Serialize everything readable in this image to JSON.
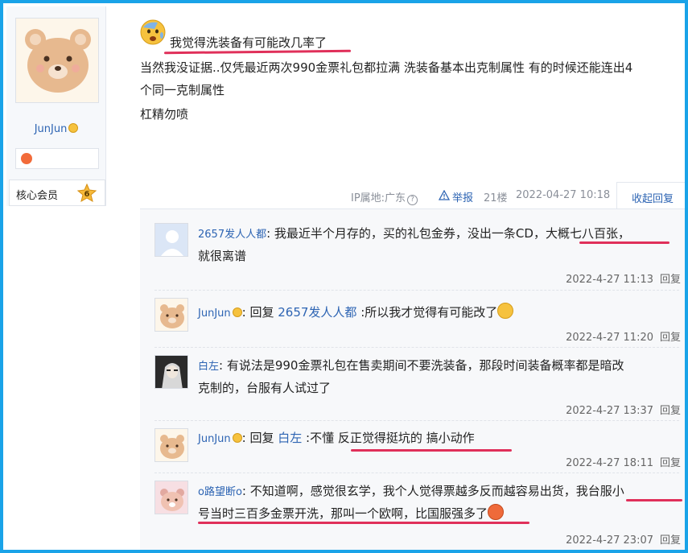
{
  "author": {
    "name": "JunJun",
    "member_label": "核心会员",
    "member_level": "6"
  },
  "post": {
    "title": "我觉得洗装备有可能改几率了",
    "lines": [
      "当然我没证据..仅凭最近两次990金票礼包都拉满 洗装备基本出克制属性 有的时候还能连出4",
      "个同一克制属性",
      "杠精勿喷"
    ],
    "ip_location": "IP属地:广东",
    "report_label": "举报",
    "floor": "21楼",
    "timestamp": "2022-04-27 10:18",
    "collapse_label": "收起回复"
  },
  "replies": [
    {
      "user": "2657发人人都",
      "text_before": "我最近半个月存的，买的礼包金券，没出一条CD，",
      "highlight": "大概七八百张，",
      "line2": "就很离谱",
      "time": "2022-4-27 11:13",
      "reply_label": "回复"
    },
    {
      "user": "JunJun",
      "reply_prefix": "回复",
      "reply_to": "2657发人人都",
      "text": ":所以我才觉得有可能改了",
      "time": "2022-4-27 11:20",
      "reply_label": "回复"
    },
    {
      "user": "白左",
      "text_line1": "有说法是990金票礼包在售卖期间不要洗装备，那段时间装备概率都是暗改",
      "text_line2": "克制的，台服有人试过了",
      "time": "2022-4-27 13:37",
      "reply_label": "回复"
    },
    {
      "user": "JunJun",
      "reply_prefix": "回复",
      "reply_to": "白左",
      "text_plain": ":不懂 ",
      "text_highlight": "反正觉得挺坑的 搞小动作",
      "time": "2022-4-27 18:11",
      "reply_label": "回复"
    },
    {
      "user": "o路望断o",
      "text_line1": "不知道啊，感觉很玄学，我个人觉得票越多反而越容易出货，我台服小",
      "text_line2": "号当时三百多金票开洗，那叫一个欧啊，比国服强多了",
      "time": "2022-4-27 23:07",
      "reply_label": "回复"
    }
  ],
  "colors": {
    "frame": "#1aa3e8",
    "link": "#2d64b3",
    "highlight_underline": "#e0305a"
  }
}
